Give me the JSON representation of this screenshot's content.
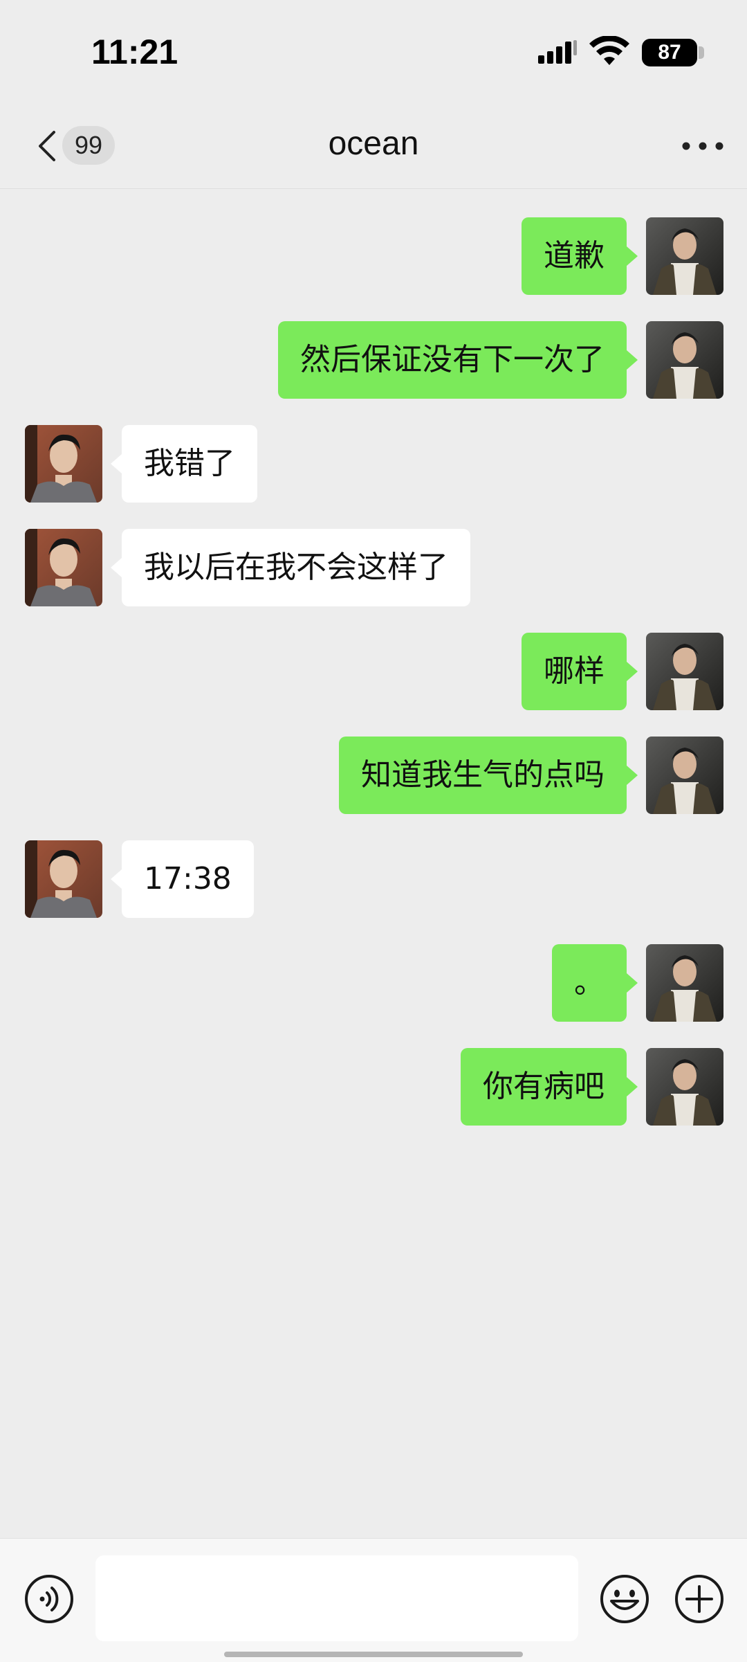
{
  "status_bar": {
    "time": "11:21",
    "battery": "87",
    "icons": [
      "signal-icon",
      "wifi-icon",
      "battery-icon"
    ]
  },
  "header": {
    "unread_count": "99",
    "title": "ocean",
    "icons": [
      "back-chevron-icon",
      "more-icon"
    ]
  },
  "messages": [
    {
      "side": "right",
      "text": "道歉"
    },
    {
      "side": "right",
      "text": "然后保证没有下一次了"
    },
    {
      "side": "left",
      "text": "我错了"
    },
    {
      "side": "left",
      "text": "我以后在我不会这样了"
    },
    {
      "side": "right",
      "text": "哪样"
    },
    {
      "side": "right",
      "text": "知道我生气的点吗"
    },
    {
      "side": "left",
      "text": "17:38"
    },
    {
      "side": "right",
      "text": "。"
    },
    {
      "side": "right",
      "text": "你有病吧"
    }
  ],
  "input_bar": {
    "icons": [
      "voice-icon",
      "emoji-icon",
      "plus-icon"
    ]
  },
  "colors": {
    "background": "#ededed",
    "sent_bubble": "#7bea5a",
    "received_bubble": "#ffffff"
  }
}
